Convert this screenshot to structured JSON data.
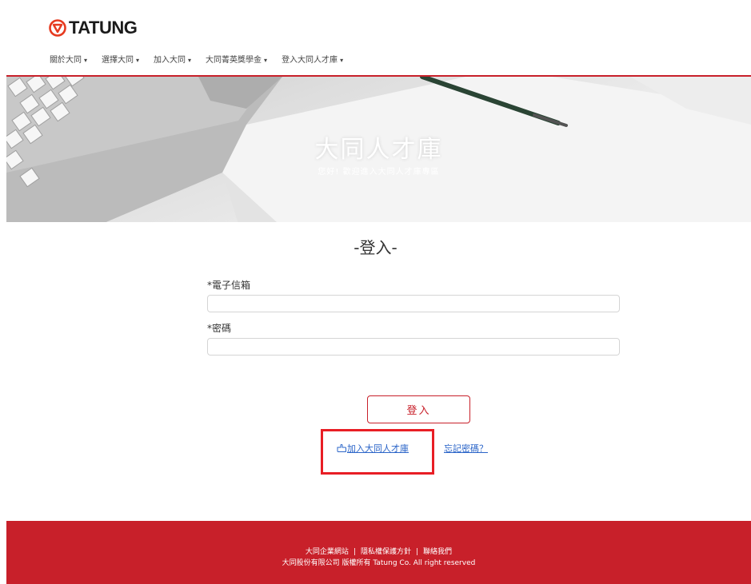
{
  "brand": {
    "logo_text": "TATUNG"
  },
  "nav": {
    "items": [
      {
        "label": "關於大同"
      },
      {
        "label": "選擇大同"
      },
      {
        "label": "加入大同"
      },
      {
        "label": "大同菁英獎學金"
      },
      {
        "label": "登入大同人才庫"
      }
    ]
  },
  "hero": {
    "title": "大同人才庫",
    "subtitle": "您好! 歡迎進入大同人才庫專區"
  },
  "login": {
    "title": "-登入-",
    "email_label": "*電子信箱",
    "email_value": "",
    "password_label": "*密碼",
    "password_value": "",
    "submit_label": "登入",
    "join_link": "加入大同人才庫",
    "forgot_link": "忘記密碼？"
  },
  "footer": {
    "links": [
      "大同企業網站",
      "隱私權保護方針",
      "聯絡我們"
    ],
    "copyright": "大同股份有限公司 版權所有 Tatung Co. All right reserved"
  },
  "colors": {
    "brand_red": "#c8202a",
    "highlight_red": "#e81e25",
    "link_blue": "#2a64c8"
  }
}
